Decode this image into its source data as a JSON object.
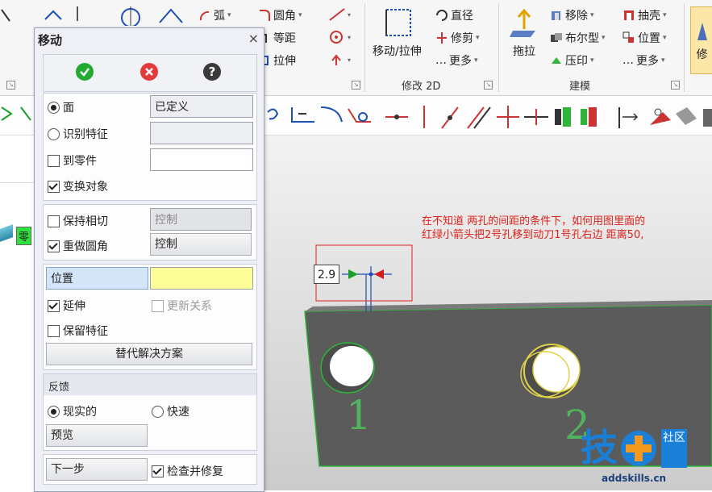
{
  "ribbon": {
    "items": {
      "arc": "弧",
      "fillet": "圆角",
      "offset": "等距",
      "stretch": "拉伸",
      "move_stretch": "移动/拉伸",
      "diameter": "直径",
      "trim": "修剪",
      "more1": "更多",
      "pull": "拖拉",
      "move": "移除",
      "boolean": "布尔型",
      "emboss": "压印",
      "shell": "抽壳",
      "position": "位置",
      "more2": "更多",
      "modify_short": "修"
    },
    "groups": {
      "modify2d": "修改 2D",
      "modeling": "建模"
    }
  },
  "dialog": {
    "title": "移动",
    "close": "×",
    "sec1": {
      "face_label": "面",
      "face_value": "已定义",
      "identify_label": "识别特征",
      "identify_value": "",
      "to_part_label": "到零件",
      "to_part_value": "",
      "transform_label": "变换对象"
    },
    "sec2": {
      "keep_tangent_label": "保持相切",
      "keep_tangent_value": "控制",
      "redo_fillet_label": "重做圆角",
      "redo_fillet_value": "控制"
    },
    "sec3": {
      "position_label": "位置",
      "position_value": "",
      "extend_label": "延伸",
      "update_relation_label": "更新关系",
      "keep_feature_label": "保留特征",
      "alternative_button": "替代解决方案"
    },
    "feedback": {
      "header": "反馈",
      "realistic_label": "现实的",
      "fast_label": "快速",
      "preview_button": "预览"
    },
    "footer": {
      "next_button": "下一步",
      "check_repair_label": "检查并修复"
    }
  },
  "tree": {
    "part_label": "零"
  },
  "viewport": {
    "dimension_value": "2.9",
    "annotation_line1": "在不知道 两孔的间距的条件下，如何用图里面的",
    "annotation_line2": "红绿小箭头把2号孔移到动刀1号孔右边 距离50,",
    "hole1_label": "1",
    "hole2_label": "2"
  },
  "watermark": {
    "logo_char": "技",
    "community": "社区",
    "domain": "addskills.cn"
  },
  "colors": {
    "annotation_red": "#e0211a",
    "position_highlight": "#ffff99",
    "ok_green": "#22aa33",
    "cancel_red": "#e23b3b"
  }
}
